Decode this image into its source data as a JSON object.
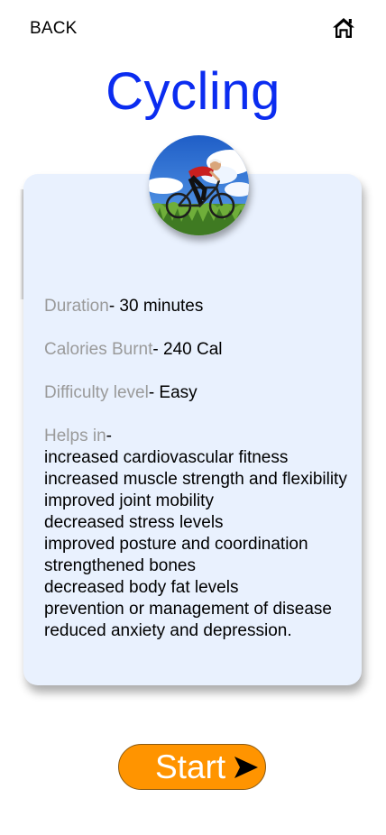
{
  "header": {
    "back_label": "BACK",
    "home_icon": "home-icon"
  },
  "title": "Cycling",
  "colors": {
    "title": "#0b2cf0",
    "card_background": "#e9f1fe",
    "start_button": "#ff9400"
  },
  "details": {
    "duration_label": "Duration",
    "duration_value": "- 30 minutes",
    "calories_label": "Calories Burnt",
    "calories_value": "- 240 Cal",
    "difficulty_label": "Difficulty level",
    "difficulty_value": "- Easy",
    "helps_label": "Helps in",
    "helps_value": "-"
  },
  "benefits": [
    "increased cardiovascular fitness",
    "increased muscle strength and flexibility",
    "improved joint mobility",
    "decreased stress levels",
    "improved posture and coordination",
    "strengthened bones",
    "decreased body fat levels",
    "prevention or management of disease",
    "reduced anxiety and depression."
  ],
  "start_button": {
    "label": "Start",
    "icon": "play-arrow-icon"
  }
}
